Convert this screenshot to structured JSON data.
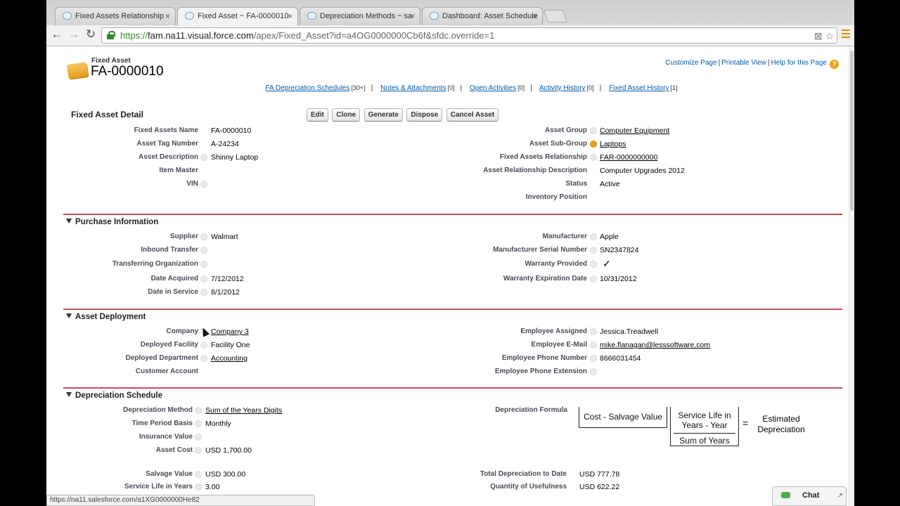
{
  "browser": {
    "tabs": [
      {
        "title": "Fixed Assets Relationship",
        "active": false
      },
      {
        "title": "Fixed Asset ~ FA-0000010",
        "active": true
      },
      {
        "title": "Depreciation Methods ~ sa",
        "active": false
      },
      {
        "title": "Dashboard: Asset Schedule",
        "active": false
      }
    ],
    "url_scheme": "https://",
    "url_host": "fam.na11.visual.force.com",
    "url_path": "/apex/Fixed_Asset?id=a4OG0000000Cb6f&sfdc.override=1"
  },
  "header": {
    "type": "Fixed Asset",
    "title": "FA-0000010",
    "links": [
      "Customize Page",
      "Printable View",
      "Help for this Page"
    ]
  },
  "related_lists": [
    {
      "label": "FA Depreciation Schedules",
      "count": "[30+]"
    },
    {
      "label": "Notes & Attachments",
      "count": "[0]"
    },
    {
      "label": "Open Activities",
      "count": "[0]"
    },
    {
      "label": "Activity History",
      "count": "[0]"
    },
    {
      "label": "Fixed Asset History",
      "count": "[1]"
    }
  ],
  "detail": {
    "title": "Fixed Asset Detail",
    "buttons": [
      "Edit",
      "Clone",
      "Generate",
      "Dispose",
      "Cancel Asset"
    ],
    "left": [
      {
        "label": "Fixed Assets Name",
        "value": "FA-0000010"
      },
      {
        "label": "Asset Tag Number",
        "value": "A-24234"
      },
      {
        "label": "Asset Description",
        "value": "Shinny Laptop"
      },
      {
        "label": "Item Master",
        "value": ""
      },
      {
        "label": "VIN",
        "value": ""
      }
    ],
    "right": [
      {
        "label": "Asset Group",
        "value": "Computer Equipment"
      },
      {
        "label": "Asset Sub-Group",
        "value": "Laptops"
      },
      {
        "label": "Fixed Assets Relationship",
        "value": "FAR-0000000000"
      },
      {
        "label": "Asset Relationship Description",
        "value": "Computer Upgrades 2012"
      },
      {
        "label": "Status",
        "value": "Active"
      },
      {
        "label": "Inventory Position",
        "value": ""
      }
    ]
  },
  "purchase": {
    "title": "Purchase Information",
    "left": [
      {
        "label": "Supplier",
        "value": "Walmart"
      },
      {
        "label": "Inbound Transfer",
        "value": ""
      },
      {
        "label": "Transferring Organization",
        "value": ""
      },
      {
        "label": "Date Acquired",
        "value": "7/12/2012"
      },
      {
        "label": "Date in Service",
        "value": "8/1/2012"
      }
    ],
    "right": [
      {
        "label": "Manufacturer",
        "value": "Apple"
      },
      {
        "label": "Manufacturer Serial Number",
        "value": "SN2347824"
      },
      {
        "label": "Warranty Provided",
        "value": "✓"
      },
      {
        "label": "Warranty Expiration Date",
        "value": "10/31/2012"
      }
    ]
  },
  "deployment": {
    "title": "Asset Deployment",
    "left": [
      {
        "label": "Company",
        "value": "Company 3"
      },
      {
        "label": "Deployed Facility",
        "value": "Facility One"
      },
      {
        "label": "Deployed Department",
        "value": "Accounting"
      },
      {
        "label": "Customer Account",
        "value": ""
      }
    ],
    "right": [
      {
        "label": "Employee Assigned",
        "value": "Jessica.Treadwell"
      },
      {
        "label": "Employee E-Mail",
        "value": "mike.flanagan@lesssoftware.com"
      },
      {
        "label": "Employee Phone Number",
        "value": "8666031454"
      },
      {
        "label": "Employee Phone Extension",
        "value": ""
      }
    ]
  },
  "depreciation": {
    "title": "Depreciation Schedule",
    "left": [
      {
        "label": "Depreciation Method",
        "value": "Sum of the Years Digits"
      },
      {
        "label": "Time Period Basis",
        "value": "Monthly"
      },
      {
        "label": "Insurance Value",
        "value": ""
      },
      {
        "label": "Asset Cost",
        "value": "USD 1,700.00"
      },
      {
        "label": "Salvage Value",
        "value": "USD 300.00"
      },
      {
        "label": "Service Life in Years",
        "value": "3.00"
      }
    ],
    "formula_label": "Depreciation Formula",
    "formula": {
      "term1": "Cost - Salvage Value",
      "numerator": "Service Life in Years - Year",
      "denominator": "Sum of Years",
      "equals": "=",
      "result": "Estimated Depreciation"
    },
    "right_bottom": [
      {
        "label": "Total Depreciation to Date",
        "value": "USD 777.78"
      },
      {
        "label": "Quantity of Usefulness",
        "value": "USD 622.22"
      }
    ]
  },
  "status_url": "https://na11.salesforce.com/a1XG0000000He82",
  "chat_label": "Chat",
  "colors": {
    "link": "#015ba7",
    "section_rule": "#c4525c",
    "help": "#e8a317"
  }
}
